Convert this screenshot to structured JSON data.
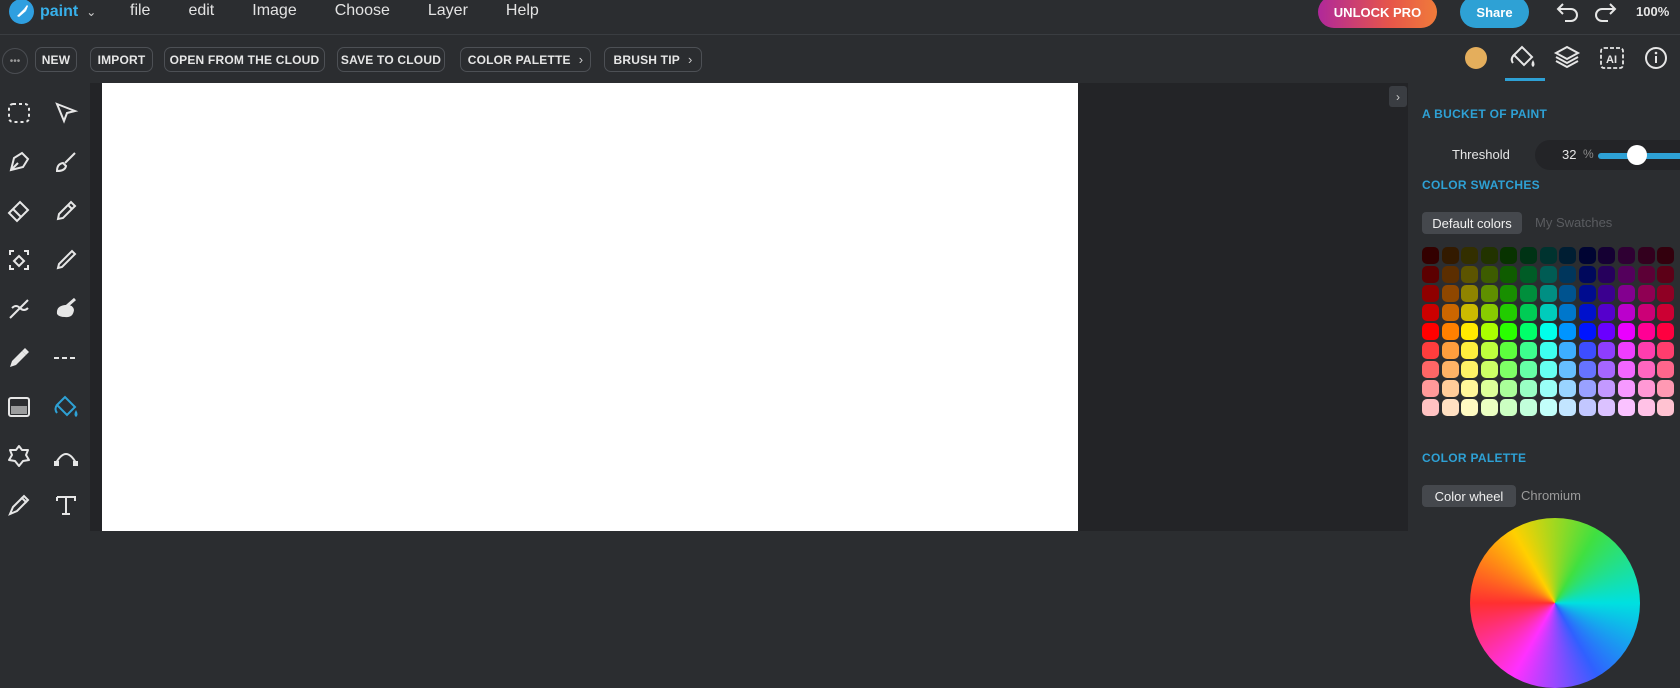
{
  "app": {
    "name": "paint"
  },
  "menu": [
    "file",
    "edit",
    "Image",
    "Choose",
    "Layer",
    "Help"
  ],
  "header": {
    "unlock_label": "UNLOCK PRO",
    "share_label": "Share",
    "zoom": "100%"
  },
  "toolbar": {
    "buttons": [
      "NEW",
      "IMPORT",
      "OPEN FROM THE CLOUD",
      "SAVE TO CLOUD",
      "COLOR PALETTE",
      "BRUSH TIP"
    ],
    "current_color": "#e4ae5c",
    "right_icons": [
      "paint-bucket-icon",
      "layers-icon",
      "ai-icon",
      "info-icon"
    ]
  },
  "tools": [
    "rectangle-select-icon",
    "pointer-icon",
    "pen-icon",
    "brush-icon",
    "eraser-icon",
    "pencil-icon",
    "magic-eraser-icon",
    "thin-pencil-icon",
    "smudge-icon",
    "paint-splash-icon",
    "marker-icon",
    "dashed-line-icon",
    "pattern-fill-icon",
    "paint-bucket-icon",
    "lasso-shape-icon",
    "bezier-curve-icon",
    "highlighter-icon",
    "text-icon"
  ],
  "panel": {
    "bucket_title": "A BUCKET OF PAINT",
    "threshold_label": "Threshold",
    "threshold_value": "32",
    "threshold_unit": "%",
    "threshold_fraction": 0.32,
    "swatches_title": "COLOR SWATCHES",
    "swatch_tabs": [
      "Default colors",
      "My Swatches"
    ],
    "palette_title": "COLOR PALETTE",
    "palette_tabs": [
      "Color wheel",
      "Chromium"
    ]
  },
  "colors": {
    "accent": "#2ea1d5",
    "canvas": "#ffffff"
  }
}
